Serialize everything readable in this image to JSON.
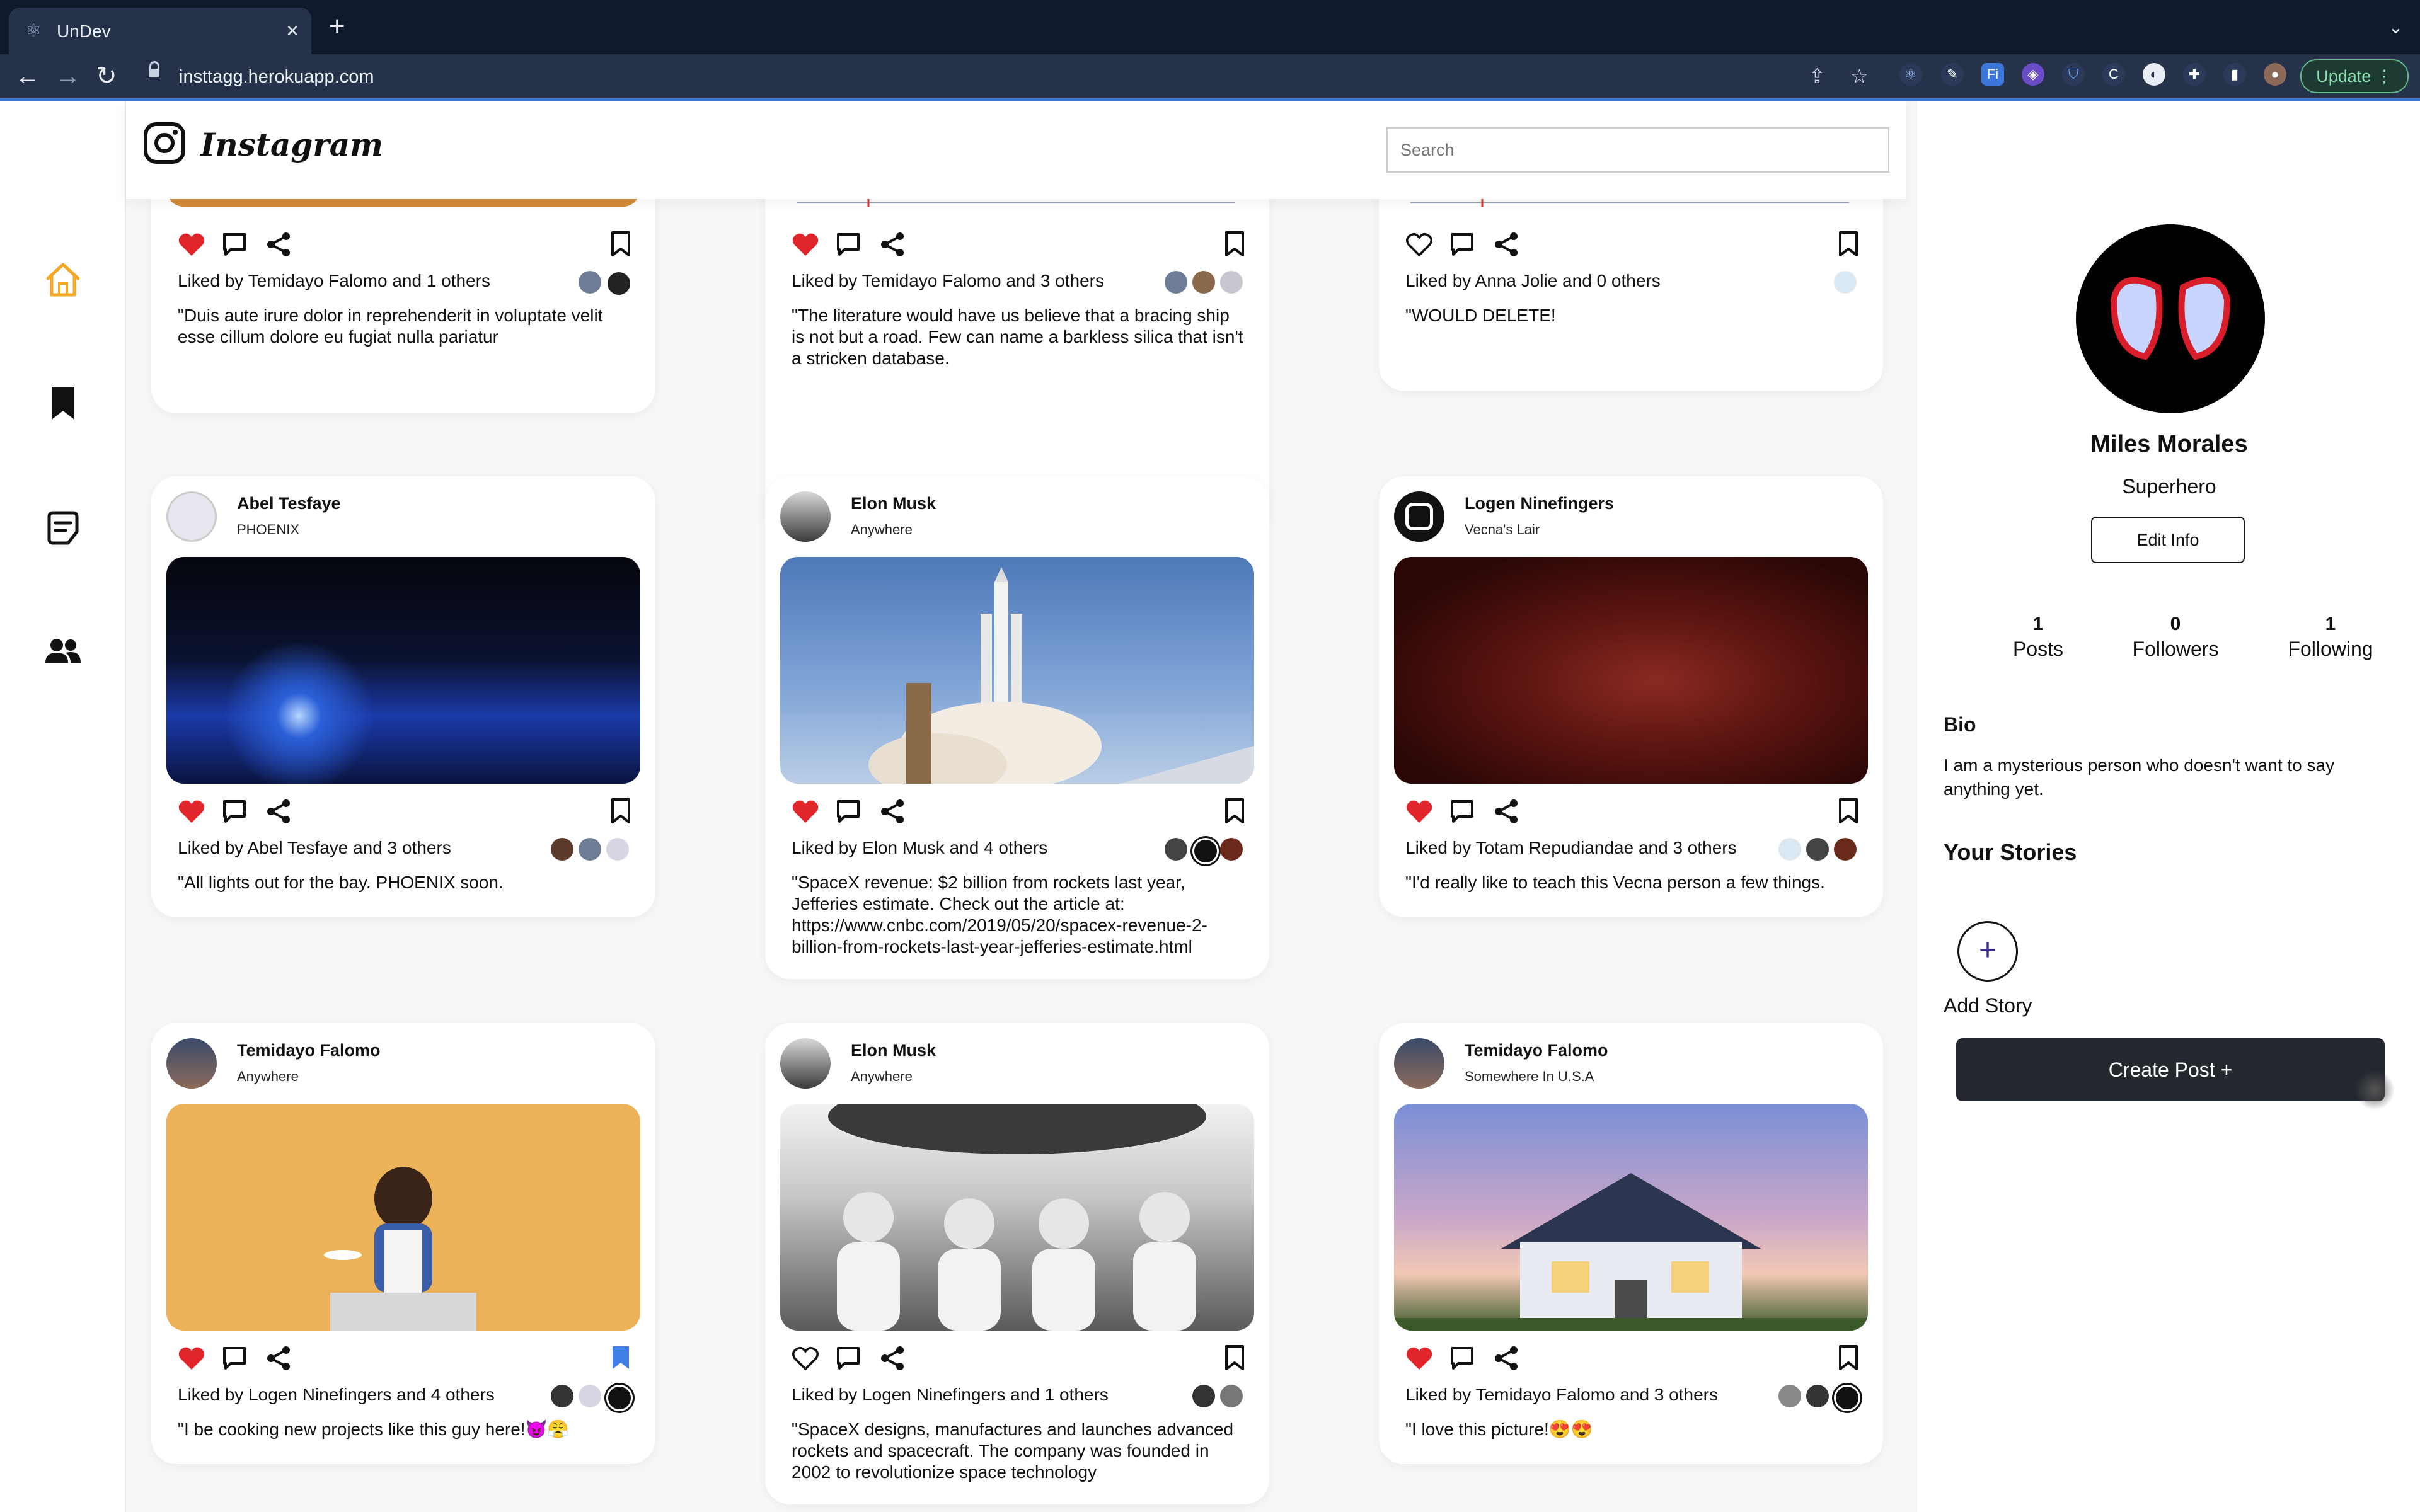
{
  "browser": {
    "tab_title": "UnDev",
    "url": "insttagg.herokuapp.com",
    "update_label": "Update"
  },
  "header": {
    "logo_text": "Instagram",
    "search_placeholder": "Search"
  },
  "posts": [
    {
      "user": "",
      "location": "",
      "liked_by": "Liked by Temidayo Falomo and 1 others",
      "caption": "\"Duis aute irure dolor in reprehenderit in voluptate velit esse cillum dolore eu fugiat nulla pariatur",
      "liked": true,
      "saved": false
    },
    {
      "user": "",
      "location": "",
      "liked_by": "Liked by Temidayo Falomo and 3 others",
      "caption": "\"The literature would have us believe that a bracing ship is not but a road. Few can name a barkless silica that isn't a stricken database.",
      "liked": true,
      "saved": false
    },
    {
      "user": "",
      "location": "",
      "liked_by": "Liked by Anna Jolie and 0 others",
      "caption": "\"WOULD DELETE!",
      "liked": false,
      "saved": false
    },
    {
      "user": "Abel Tesfaye",
      "location": "PHOENIX",
      "liked_by": "Liked by Abel Tesfaye and 3 others",
      "caption": "\"All lights out for the bay. PHOENIX soon.",
      "liked": true,
      "saved": false
    },
    {
      "user": "Elon Musk",
      "location": "Anywhere",
      "liked_by": "Liked by Elon Musk and 4 others",
      "caption": "\"SpaceX revenue: $2 billion from rockets last year, Jefferies estimate. Check out the article at: https://www.cnbc.com/2019/05/20/spacex-revenue-2-billion-from-rockets-last-year-jefferies-estimate.html",
      "liked": true,
      "saved": false
    },
    {
      "user": "Logen Ninefingers",
      "location": "Vecna's Lair",
      "liked_by": "Liked by Totam Repudiandae and 3 others",
      "caption": "\"I'd really like to teach this Vecna person a few things.",
      "liked": true,
      "saved": false
    },
    {
      "user": "Temidayo Falomo",
      "location": "Anywhere",
      "liked_by": "Liked by Logen Ninefingers and 4 others",
      "caption": "\"I be cooking new projects like this guy here!😈😤",
      "liked": true,
      "saved": true
    },
    {
      "user": "Elon Musk",
      "location": "Anywhere",
      "liked_by": "Liked by Logen Ninefingers and 1 others",
      "caption": "\"SpaceX designs, manufactures and launches advanced rockets and spacecraft. The company was founded in 2002 to revolutionize space technology",
      "liked": false,
      "saved": false
    },
    {
      "user": "Temidayo Falomo",
      "location": "Somewhere In U.S.A",
      "liked_by": "Liked by Temidayo Falomo and 3 others",
      "caption": "\"I love this picture!😍😍",
      "liked": true,
      "saved": false
    }
  ],
  "profile": {
    "name": "Miles Morales",
    "title": "Superhero",
    "edit_label": "Edit Info",
    "stats": [
      {
        "num": "1",
        "label": "Posts"
      },
      {
        "num": "0",
        "label": "Followers"
      },
      {
        "num": "1",
        "label": "Following"
      }
    ],
    "bio_heading": "Bio",
    "bio_text": "I am a mysterious person who doesn't want to say anything yet.",
    "stories_heading": "Your Stories",
    "add_story_label": "Add Story",
    "create_post_label": "Create Post"
  },
  "colors": {
    "accent": "#f5a623",
    "like": "#e0252b",
    "saved": "#3f7fe6",
    "button_dark": "#23272e"
  }
}
